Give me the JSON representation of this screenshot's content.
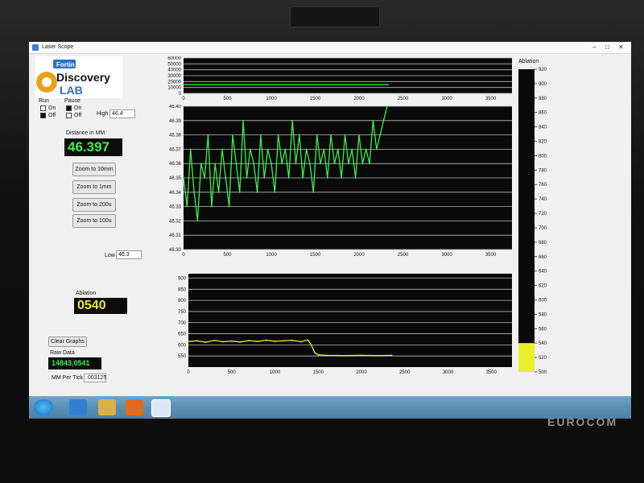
{
  "window": {
    "title": "Laser Scope",
    "minimize_glyph": "–",
    "maximize_glyph": "□",
    "close_glyph": "✕"
  },
  "logo": {
    "brand_top": "Fortin",
    "brand_mid": "Discovery",
    "brand_bottom": "LAB"
  },
  "controls": {
    "run_label": "Run",
    "pause_label": "Pause",
    "on_label": "On",
    "off_label": "Off",
    "run_state": "Off",
    "pause_state": "On",
    "high_label": "High",
    "high_value": "46.4",
    "low_label": "Low",
    "low_value": "46.3",
    "distance_label": "Distance in MM",
    "distance_value": "46.397",
    "zoom_buttons": [
      "Zoom to 10mm",
      "Zoom to 1mm",
      "Zoom to 200u",
      "Zoom to 100u"
    ],
    "ablation_label": "Ablation",
    "ablation_value": "0540",
    "clear_label": "Clear Graphs",
    "raw_label": "Raw Data",
    "raw_value": "14843,0541",
    "mm_per_tick_label": "MM Per Tick",
    "mm_per_tick_value": ".003125"
  },
  "colors": {
    "plot_bg": "#0a0a0a",
    "trace_green": "#3cf04a",
    "trace_yellow": "#e8f02a",
    "lcd_green": "#3cf04a",
    "lcd_yellow": "#f2e82a"
  },
  "chart_data": [
    {
      "id": "overview",
      "type": "line",
      "xlim": [
        0,
        4000
      ],
      "ylim": [
        0,
        60000
      ],
      "x_ticks": [
        0,
        500,
        1000,
        1500,
        2000,
        2500,
        3000,
        3500,
        4000
      ],
      "y_ticks": [
        0,
        10000,
        20000,
        30000,
        40000,
        50000,
        60000
      ],
      "series": [
        {
          "x": [
            0,
            2330
          ],
          "y": [
            14843,
            14843
          ]
        }
      ]
    },
    {
      "id": "distance",
      "type": "line",
      "xlim": [
        0,
        4000
      ],
      "ylim": [
        46.3,
        46.4
      ],
      "x_ticks": [
        0,
        500,
        1000,
        1500,
        2000,
        2500,
        3000,
        3500,
        4000
      ],
      "y_ticks": [
        46.3,
        46.31,
        46.32,
        46.33,
        46.34,
        46.35,
        46.36,
        46.37,
        46.38,
        46.39,
        46.4
      ],
      "series": [
        {
          "x": [
            0,
            40,
            80,
            120,
            160,
            200,
            240,
            280,
            320,
            360,
            400,
            440,
            480,
            520,
            560,
            600,
            640,
            680,
            720,
            760,
            800,
            840,
            880,
            920,
            960,
            1000,
            1040,
            1080,
            1120,
            1160,
            1200,
            1240,
            1280,
            1320,
            1360,
            1400,
            1440,
            1480,
            1520,
            1560,
            1600,
            1640,
            1680,
            1720,
            1760,
            1800,
            1840,
            1880,
            1920,
            1960,
            2000,
            2040,
            2080,
            2120,
            2160,
            2200,
            2240,
            2280,
            2320
          ],
          "y": [
            46.35,
            46.33,
            46.37,
            46.34,
            46.32,
            46.36,
            46.35,
            46.38,
            46.33,
            46.36,
            46.34,
            46.37,
            46.35,
            46.33,
            46.38,
            46.36,
            46.34,
            46.39,
            46.35,
            46.37,
            46.36,
            46.34,
            46.38,
            46.35,
            46.37,
            46.36,
            46.34,
            46.38,
            46.36,
            46.37,
            46.35,
            46.39,
            46.36,
            46.38,
            46.35,
            46.37,
            46.36,
            46.34,
            46.38,
            46.36,
            46.37,
            46.35,
            46.38,
            46.36,
            46.37,
            46.35,
            46.38,
            46.36,
            46.37,
            46.35,
            46.38,
            46.36,
            46.37,
            46.36,
            46.39,
            46.37,
            46.38,
            46.39,
            46.4
          ]
        }
      ]
    },
    {
      "id": "ablation",
      "type": "line",
      "xlim": [
        0,
        4000
      ],
      "ylim": [
        500,
        920
      ],
      "x_ticks": [
        0,
        500,
        1000,
        1500,
        2000,
        2500,
        3000,
        3500,
        4000
      ],
      "y_ticks": [
        550,
        600,
        650,
        700,
        750,
        800,
        850,
        900
      ],
      "series": [
        {
          "x": [
            0,
            100,
            200,
            300,
            400,
            500,
            600,
            700,
            800,
            900,
            1000,
            1100,
            1200,
            1300,
            1380,
            1420,
            1460,
            1500,
            1600,
            1800,
            2000,
            2200,
            2350
          ],
          "y": [
            615,
            618,
            612,
            620,
            614,
            617,
            613,
            619,
            615,
            621,
            616,
            618,
            620,
            614,
            622,
            600,
            565,
            555,
            553,
            552,
            553,
            552,
            553
          ]
        }
      ]
    },
    {
      "id": "ablation-meter",
      "type": "bar",
      "ylim": [
        500,
        920
      ],
      "y_ticks": [
        500,
        520,
        540,
        560,
        580,
        600,
        620,
        640,
        660,
        680,
        700,
        720,
        740,
        760,
        780,
        800,
        820,
        840,
        860,
        880,
        900,
        920
      ],
      "value": 540,
      "title": "Ablation"
    }
  ]
}
